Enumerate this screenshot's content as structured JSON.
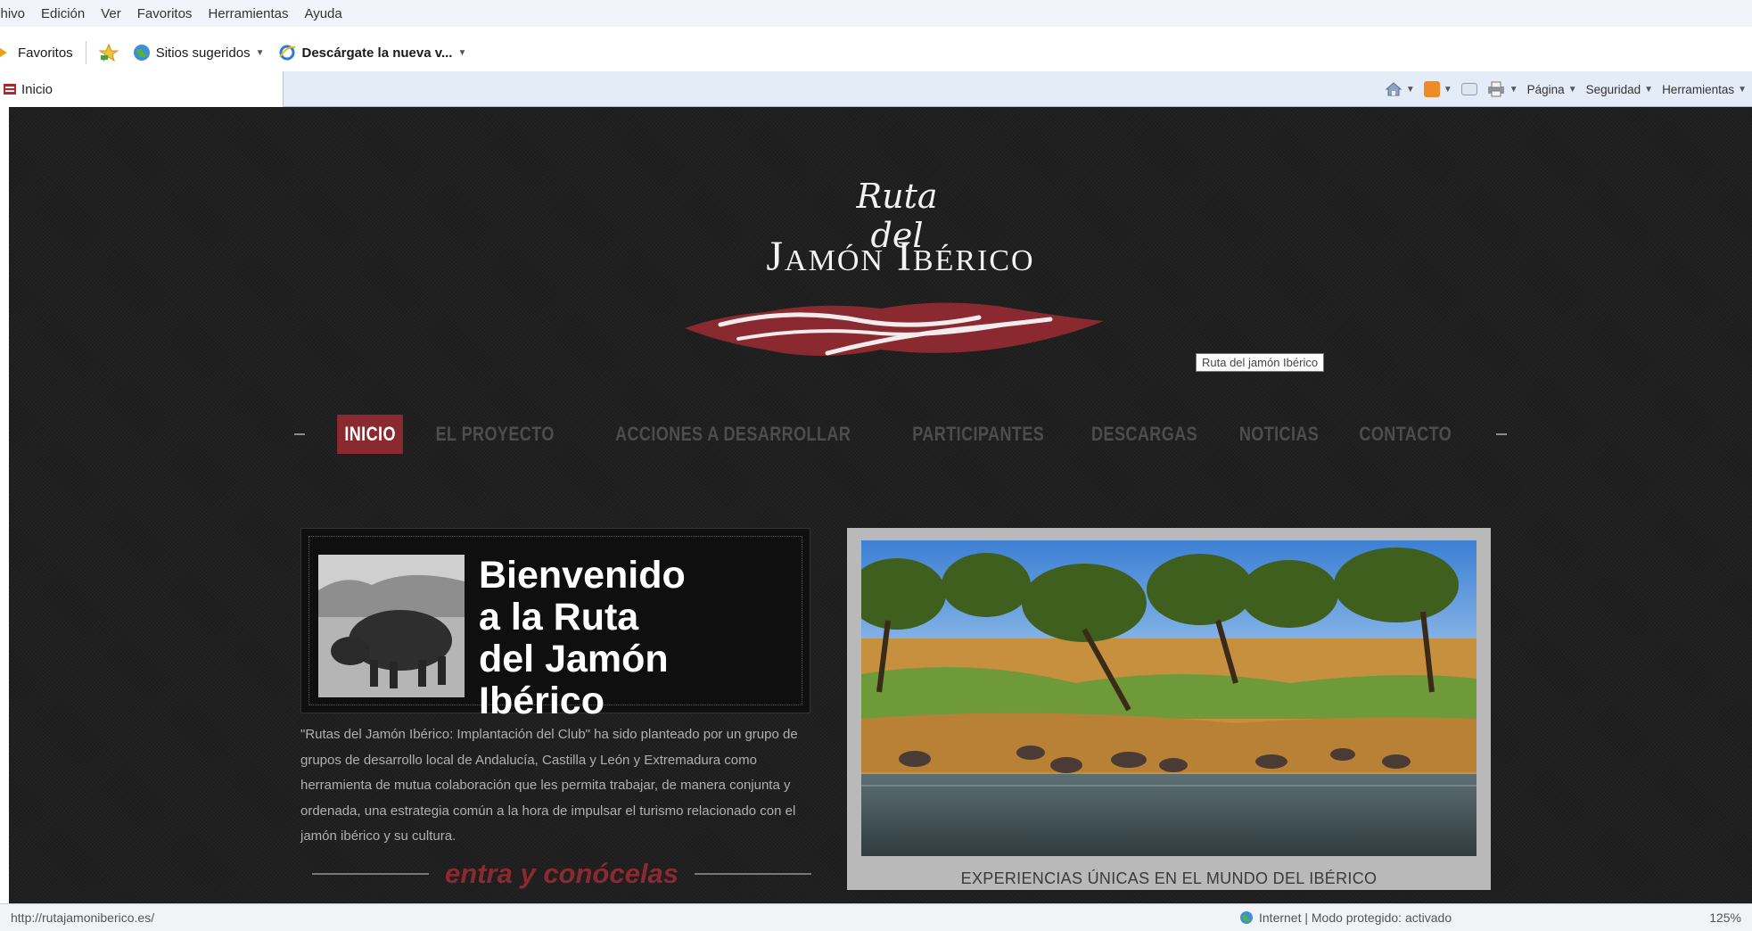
{
  "menubar": {
    "items": [
      "Archivo",
      "Edición",
      "Ver",
      "Favoritos",
      "Herramientas",
      "Ayuda"
    ]
  },
  "favorites_bar": {
    "favorites_label": "Favoritos",
    "suggested_sites_label": "Sitios sugeridos",
    "download_label": "Descárgate la nueva v..."
  },
  "tab": {
    "title": "Inicio"
  },
  "command_bar": {
    "page_label": "Página",
    "security_label": "Seguridad",
    "tools_label": "Herramientas",
    "icons": [
      "home-icon",
      "rss-feed-icon",
      "read-mail-icon",
      "print-icon"
    ]
  },
  "site": {
    "logo_script": "Ruta del",
    "logo_main": "Jamón Ibérico",
    "logo_tooltip": "Ruta del jamón Ibérico",
    "nav": [
      {
        "label": "INICIO",
        "active": true
      },
      {
        "label": "EL PROYECTO",
        "active": false
      },
      {
        "label": "ACCIONES A DESARROLLAR",
        "active": false
      },
      {
        "label": "PARTICIPANTES",
        "active": false
      },
      {
        "label": "DESCARGAS",
        "active": false
      },
      {
        "label": "NOTICIAS",
        "active": false
      },
      {
        "label": "CONTACTO",
        "active": false
      }
    ],
    "welcome_title": "Bienvenido\na la Ruta\ndel Jamón Ibérico",
    "intro_text": "\"Rutas del Jamón Ibérico: Implantación del Club\" ha sido planteado por un grupo de grupos de desarrollo local de Andalucía, Castilla y León y Extremadura como herramienta de mutua colaboración que les permita trabajar, de manera conjunta y ordenada, una estrategia común a la hora de impulsar el turismo relacionado con el jamón ibérico y su cultura.",
    "cta": "entra y conócelas",
    "photo_caption": "EXPERIENCIAS ÚNICAS EN EL MUNDO DEL IBÉRICO"
  },
  "status_bar": {
    "url": "http://rutajamoniberico.es/",
    "zone": "Internet | Modo protegido: activado",
    "zoom": "125%"
  },
  "colors": {
    "brand_red": "#8a2a30",
    "site_background": "#1f1f1f",
    "chrome_background": "#f1f4fa"
  }
}
